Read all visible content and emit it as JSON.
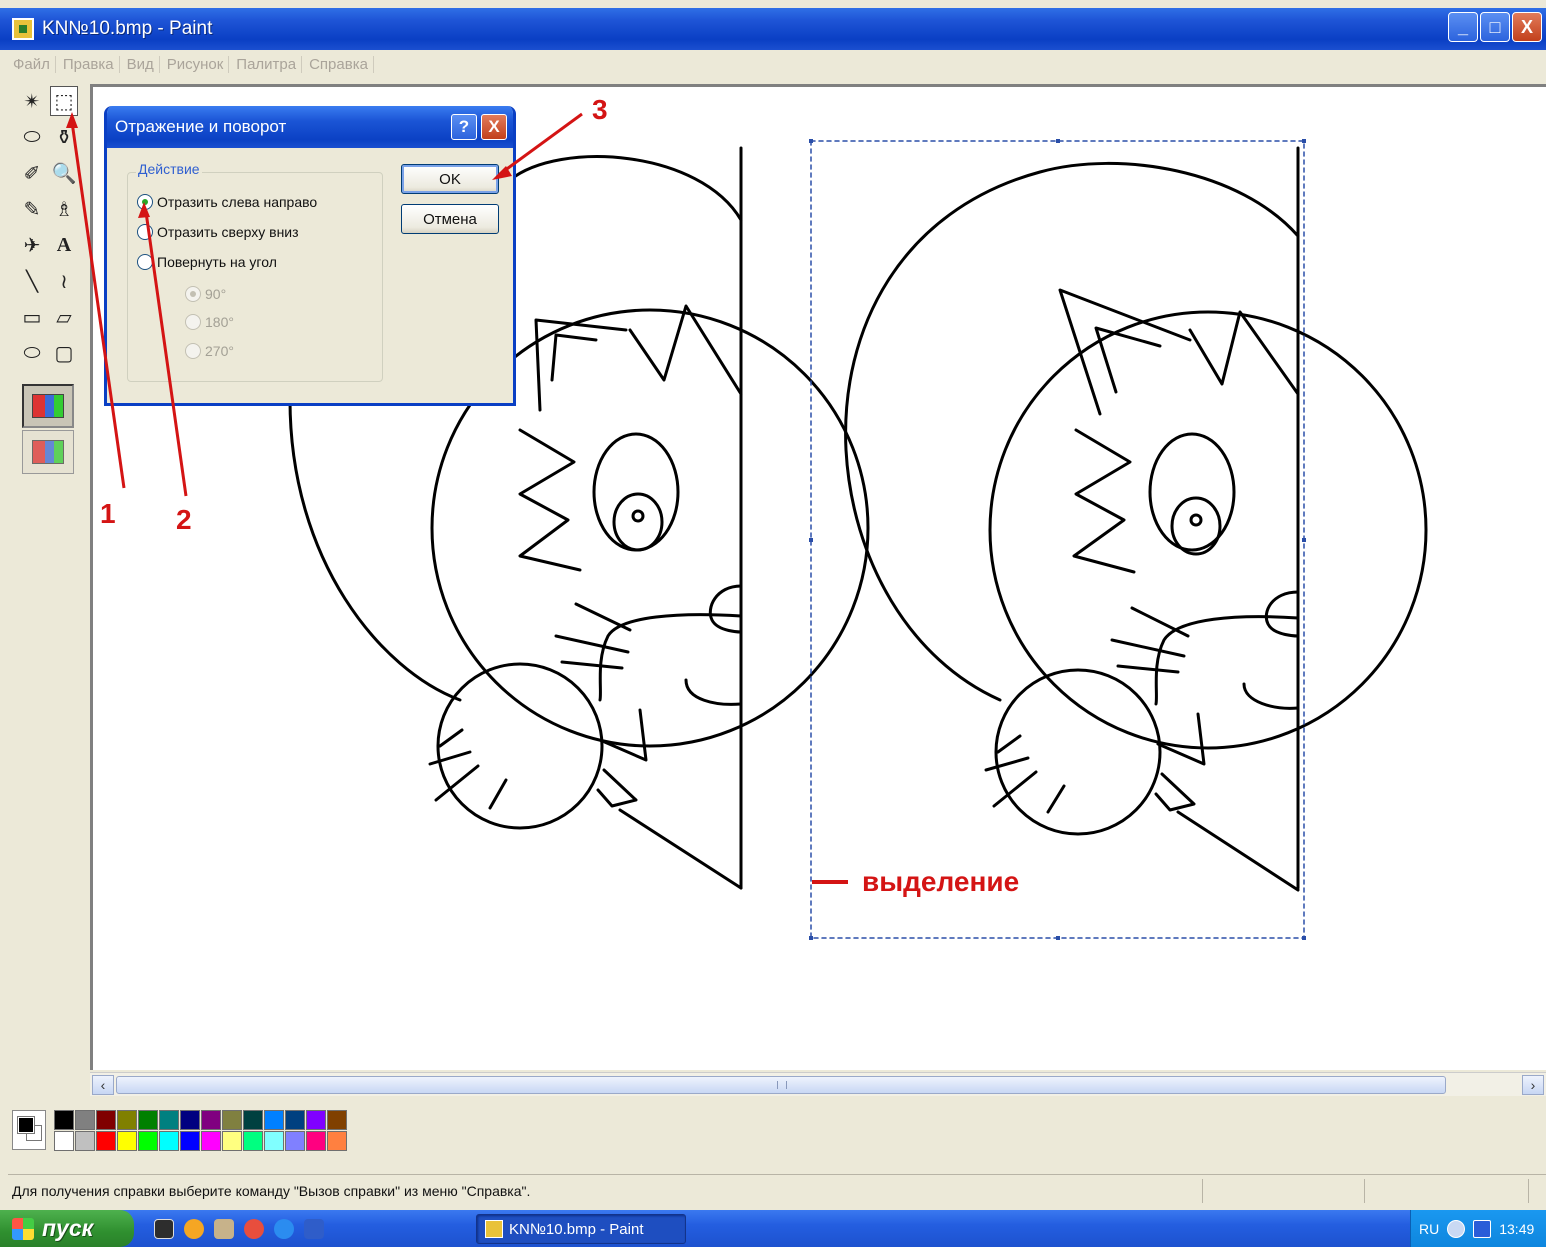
{
  "window": {
    "title": "KN№10.bmp - Paint",
    "buttons": {
      "minimize": "_",
      "maximize": "□",
      "close": "X"
    }
  },
  "menu": [
    "Файл",
    "Правка",
    "Вид",
    "Рисунок",
    "Палитра",
    "Справка"
  ],
  "tools": [
    {
      "name": "free-select-icon",
      "glyph": "✴"
    },
    {
      "name": "rect-select-icon",
      "glyph": "⬚",
      "selected": true
    },
    {
      "name": "eraser-icon",
      "glyph": "⬭"
    },
    {
      "name": "fill-bucket-icon",
      "glyph": "⚱"
    },
    {
      "name": "color-picker-icon",
      "glyph": "✐"
    },
    {
      "name": "magnifier-icon",
      "glyph": "🔍"
    },
    {
      "name": "pencil-icon",
      "glyph": "✎"
    },
    {
      "name": "brush-icon",
      "glyph": "♗"
    },
    {
      "name": "airbrush-icon",
      "glyph": "✈"
    },
    {
      "name": "text-icon",
      "glyph": "A"
    },
    {
      "name": "line-icon",
      "glyph": "╲"
    },
    {
      "name": "curve-icon",
      "glyph": "≀"
    },
    {
      "name": "rectangle-icon",
      "glyph": "▭"
    },
    {
      "name": "polygon-icon",
      "glyph": "▱"
    },
    {
      "name": "ellipse-icon",
      "glyph": "⬭"
    },
    {
      "name": "rounded-rect-icon",
      "glyph": "▢"
    }
  ],
  "dialog": {
    "title": "Отражение и поворот",
    "help": "?",
    "close": "X",
    "group_label": "Действие",
    "options": [
      {
        "label": "Отразить слева направо",
        "checked": true
      },
      {
        "label": "Отразить сверху вниз",
        "checked": false
      },
      {
        "label": "Повернуть на угол",
        "checked": false
      }
    ],
    "angles": [
      {
        "label": "90°",
        "checked": true
      },
      {
        "label": "180°",
        "checked": false
      },
      {
        "label": "270°",
        "checked": false
      }
    ],
    "ok": "OK",
    "cancel": "Отмена"
  },
  "annotations": {
    "callout_1": "1",
    "callout_2": "2",
    "callout_3": "3",
    "selection_label": "выделение",
    "color": "#d41414"
  },
  "palette": {
    "foreground": "#000000",
    "background": "#ffffff",
    "colors": [
      "#000000",
      "#808080",
      "#800000",
      "#808000",
      "#008000",
      "#008080",
      "#000080",
      "#800080",
      "#808040",
      "#004040",
      "#0080ff",
      "#004080",
      "#8000ff",
      "#804000",
      "#ffffff",
      "#c0c0c0",
      "#ff0000",
      "#ffff00",
      "#00ff00",
      "#00ffff",
      "#0000ff",
      "#ff00ff",
      "#ffff80",
      "#00ff80",
      "#80ffff",
      "#8080ff",
      "#ff0080",
      "#ff8040"
    ]
  },
  "status": "Для получения справки выберите команду \"Вызов справки\" из меню \"Справка\".",
  "taskbar": {
    "start": "пуск",
    "task": "KN№10.bmp - Paint",
    "lang": "RU",
    "time": "13:49"
  }
}
